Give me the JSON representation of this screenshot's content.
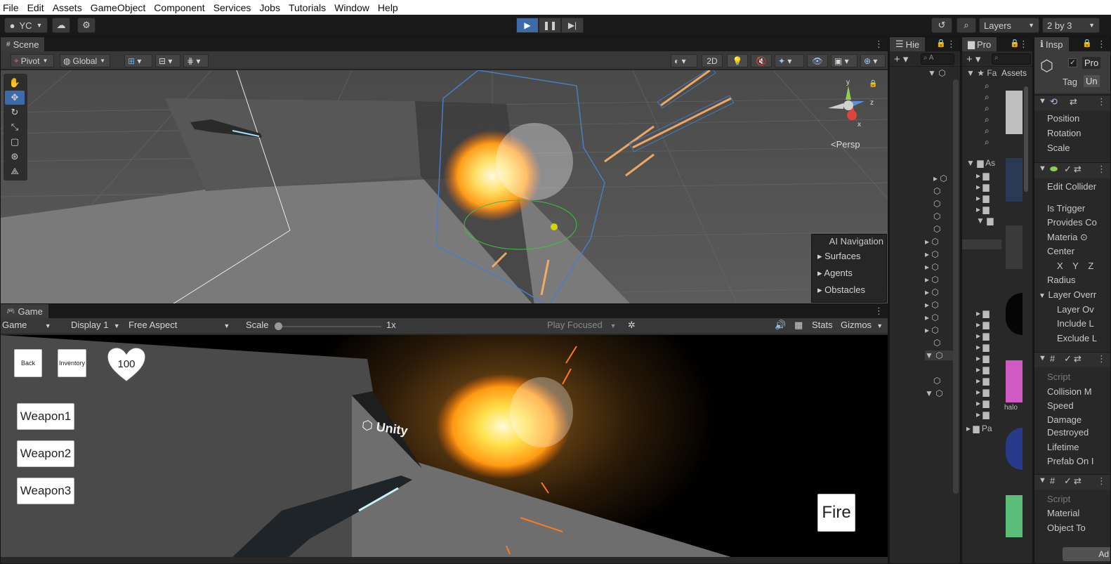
{
  "menu": [
    "File",
    "Edit",
    "Assets",
    "GameObject",
    "Component",
    "Services",
    "Jobs",
    "Tutorials",
    "Window",
    "Help"
  ],
  "toolbar": {
    "account": "YC",
    "layers": "Layers",
    "layout": "2 by 3"
  },
  "scene": {
    "tab": "Scene",
    "pivot": "Pivot",
    "global": "Global",
    "mode_2d": "2D",
    "persp": "<Persp",
    "gizmo_axes": [
      "y",
      "z",
      "x"
    ],
    "ai_navigation": {
      "title": "AI Navigation",
      "items": [
        "Surfaces",
        "Agents",
        "Obstacles"
      ]
    }
  },
  "game": {
    "tab": "Game",
    "mode": "Game",
    "display": "Display 1",
    "aspect": "Free Aspect",
    "scale_label": "Scale",
    "scale_value": "1x",
    "play_focused": "Play Focused",
    "stats": "Stats",
    "gizmos": "Gizmos",
    "hud": {
      "back": "Back",
      "inventory": "Inventory",
      "health": "100",
      "weapons": [
        "Weapon1",
        "Weapon2",
        "Weapon3"
      ],
      "fire": "Fire",
      "logo": "Unity"
    }
  },
  "hierarchy": {
    "tab": "Hie",
    "search": "A"
  },
  "project": {
    "tab": "Pro",
    "favorites": "Fa",
    "assets_root": "As",
    "packages": "Pa",
    "assets_label": "Assets",
    "thumb_label": "halo"
  },
  "inspector": {
    "tab": "Insp",
    "name_prefix": "Pro",
    "tag_label": "Tag",
    "tag_value": "Un",
    "transform": [
      "Position",
      "Rotation",
      "Scale"
    ],
    "collider": [
      "Edit Collider",
      "Is Trigger",
      "Provides Co",
      "Materia",
      "Center",
      "Radius",
      "Layer Overr",
      "Layer Ov",
      "Include L",
      "Exclude L"
    ],
    "center_axes": [
      "X",
      "Y",
      "Z"
    ],
    "script1": [
      "Script",
      "Collision M",
      "Speed",
      "Damage",
      "Destroyed",
      "Lifetime",
      "Prefab On I"
    ],
    "script2": [
      "Script",
      "Material",
      "Object To"
    ],
    "footer": "Ad"
  }
}
